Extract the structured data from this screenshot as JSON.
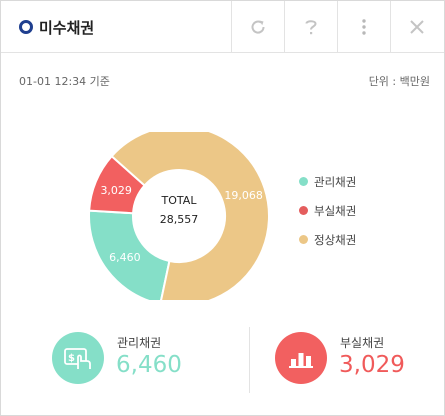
{
  "header": {
    "title": "미수채권",
    "buttons": [
      {
        "name": "refresh",
        "icon": "refresh-icon"
      },
      {
        "name": "help",
        "icon": "question-icon"
      },
      {
        "name": "more",
        "icon": "more-vertical-icon"
      },
      {
        "name": "close",
        "icon": "close-icon"
      }
    ]
  },
  "meta": {
    "timestamp": "01-01 12:34 기준",
    "unit": "단위 : 백만원"
  },
  "chart_data": {
    "type": "pie",
    "categories": [
      "관리채권",
      "부실채권",
      "정상채권"
    ],
    "values": [
      6460,
      3029,
      19068
    ],
    "value_labels": [
      "6,460",
      "3,029",
      "19,068"
    ],
    "colors": [
      "#85dfc8",
      "#f26060",
      "#ecc787"
    ],
    "center_label": "TOTAL",
    "center_value": "28,557",
    "legend_position": "right"
  },
  "stats": [
    {
      "label": "관리채권",
      "value": "6,460",
      "icon": "money-icon",
      "color": "#85dfc8",
      "value_color": "#85dfc8"
    },
    {
      "label": "부실채권",
      "value": "3,029",
      "icon": "bar-chart-icon",
      "color": "#f26060",
      "value_color": "#f05a5a"
    }
  ]
}
